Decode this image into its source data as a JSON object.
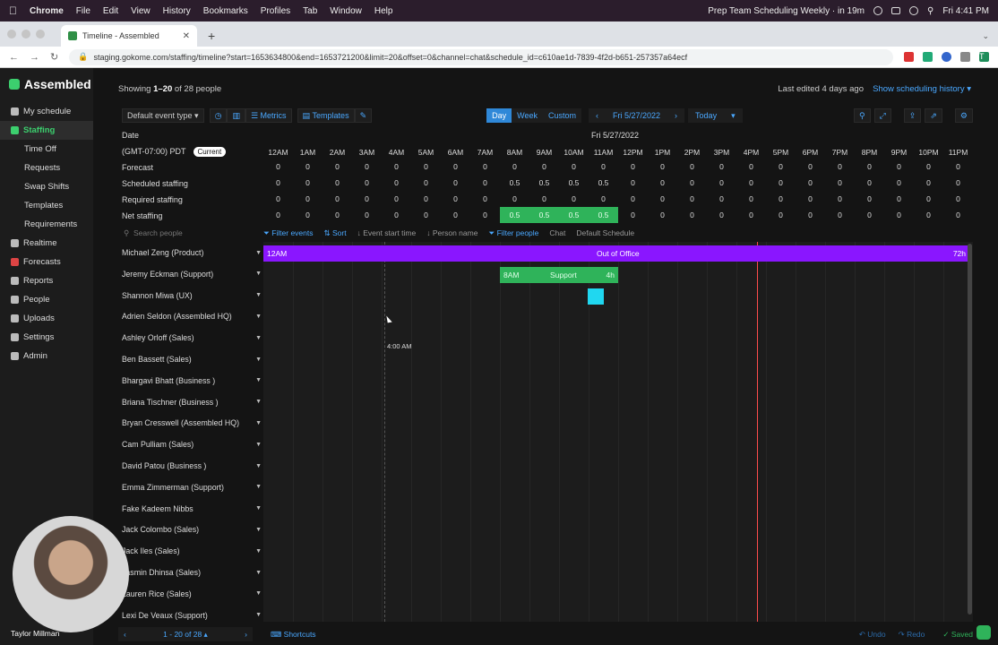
{
  "menubar": {
    "app": "Chrome",
    "items": [
      "File",
      "Edit",
      "View",
      "History",
      "Bookmarks",
      "Profiles",
      "Tab",
      "Window",
      "Help"
    ],
    "event": "Prep Team Scheduling Weekly · in 19m",
    "clock": "Fri 4:41 PM"
  },
  "browser": {
    "tab_title": "Timeline - Assembled",
    "url": "staging.gokome.com/staffing/timeline?start=1653634800&end=1653721200&limit=20&offset=0&channel=chat&schedule_id=c610ae1d-7839-4f2d-b651-257357a64ecf",
    "profile_initial": "T"
  },
  "sidebar": {
    "brand": "Assembled",
    "items": [
      {
        "label": "My schedule"
      },
      {
        "label": "Staffing"
      },
      {
        "label": "Time Off"
      },
      {
        "label": "Requests"
      },
      {
        "label": "Swap Shifts"
      },
      {
        "label": "Templates"
      },
      {
        "label": "Requirements"
      },
      {
        "label": "Realtime"
      },
      {
        "label": "Forecasts"
      },
      {
        "label": "Reports"
      },
      {
        "label": "People"
      },
      {
        "label": "Uploads"
      },
      {
        "label": "Settings"
      },
      {
        "label": "Admin"
      }
    ],
    "footer_name": "Taylor Millman"
  },
  "main": {
    "showing_prefix": "Showing ",
    "showing_range": "1–20",
    "showing_suffix": " of 28 people",
    "last_edited": "Last edited 4 days ago",
    "history_link": "Show scheduling history ▾",
    "toolbar": {
      "event_type": "Default event type ▾",
      "metrics": "Metrics",
      "templates": "Templates",
      "view_day": "Day",
      "view_week": "Week",
      "view_custom": "Custom",
      "date": "Fri 5/27/2022",
      "today": "Today"
    },
    "header": {
      "date_label": "Date",
      "date_value": "Fri 5/27/2022",
      "tz_label": "(GMT-07:00) PDT",
      "current_badge": "Current",
      "hours": [
        "12AM",
        "1AM",
        "2AM",
        "3AM",
        "4AM",
        "5AM",
        "6AM",
        "7AM",
        "8AM",
        "9AM",
        "10AM",
        "11AM",
        "12PM",
        "1PM",
        "2PM",
        "3PM",
        "4PM",
        "5PM",
        "6PM",
        "7PM",
        "8PM",
        "9PM",
        "10PM",
        "11PM"
      ],
      "rows": [
        {
          "label": "Forecast",
          "values": [
            "0",
            "0",
            "0",
            "0",
            "0",
            "0",
            "0",
            "0",
            "0",
            "0",
            "0",
            "0",
            "0",
            "0",
            "0",
            "0",
            "0",
            "0",
            "0",
            "0",
            "0",
            "0",
            "0",
            "0"
          ]
        },
        {
          "label": "Scheduled staffing",
          "values": [
            "0",
            "0",
            "0",
            "0",
            "0",
            "0",
            "0",
            "0",
            "0.5",
            "0.5",
            "0.5",
            "0.5",
            "0",
            "0",
            "0",
            "0",
            "0",
            "0",
            "0",
            "0",
            "0",
            "0",
            "0",
            "0"
          ]
        },
        {
          "label": "Required staffing",
          "values": [
            "0",
            "0",
            "0",
            "0",
            "0",
            "0",
            "0",
            "0",
            "0",
            "0",
            "0",
            "0",
            "0",
            "0",
            "0",
            "0",
            "0",
            "0",
            "0",
            "0",
            "0",
            "0",
            "0",
            "0"
          ]
        },
        {
          "label": "Net staffing",
          "values": [
            "0",
            "0",
            "0",
            "0",
            "0",
            "0",
            "0",
            "0",
            "0.5",
            "0.5",
            "0.5",
            "0.5",
            "0",
            "0",
            "0",
            "0",
            "0",
            "0",
            "0",
            "0",
            "0",
            "0",
            "0",
            "0"
          ]
        }
      ]
    },
    "filterbar": {
      "search_placeholder": "Search people",
      "filter_events": "Filter events",
      "sort": "Sort",
      "event_start": "↓ Event start time",
      "person_name": "↓ Person name",
      "filter_people": "Filter people",
      "chat": "Chat",
      "default_schedule": "Default Schedule"
    },
    "people": [
      "Michael Zeng (Product)",
      "Jeremy Eckman (Support)",
      "Shannon Miwa (UX)",
      "Adrien Seldon (Assembled HQ)",
      "Ashley Orloff (Sales)",
      "Ben Bassett (Sales)",
      "Bhargavi Bhatt (Business )",
      "Briana Tischner (Business )",
      "Bryan Cresswell (Assembled HQ)",
      "Cam Pulliam (Sales)",
      "David Patou (Business )",
      "Emma Zimmerman (Support)",
      "Fake Kadeem Nibbs",
      "Jack Colombo (Sales)",
      "Jack Iles (Sales)",
      "Jasmin Dhinsa (Sales)",
      "Lauren Rice (Sales)",
      "Lexi De Veaux (Support)"
    ],
    "events": {
      "ooo": {
        "start": "12AM",
        "label": "Out of Office",
        "duration": "72h"
      },
      "support": {
        "start": "8AM",
        "label": "Support",
        "duration": "4h"
      }
    },
    "hover_time": "4:00 AM",
    "bottom": {
      "pager": "1 - 20 of 28 ▴",
      "shortcuts": "Shortcuts",
      "undo": "Undo",
      "redo": "Redo",
      "saved": "Saved"
    }
  },
  "colors": {
    "accent_green": "#3ccf6e",
    "accent_blue": "#4aa8ff",
    "ooo_purple": "#8a16ff",
    "support_green": "#2fb35a",
    "now_line": "#ff4b4b"
  }
}
